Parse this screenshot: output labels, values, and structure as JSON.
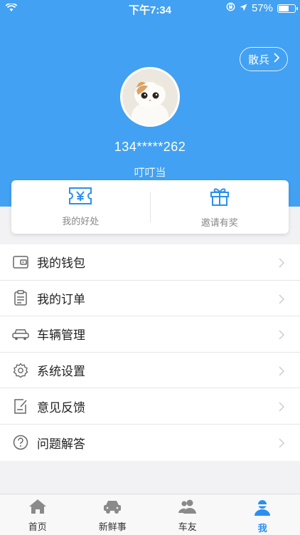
{
  "status_bar": {
    "time": "下午7:34",
    "battery": "57%",
    "battery_level": 0.57
  },
  "header": {
    "group_button": "散兵",
    "phone": "134*****262",
    "nickname": "叮叮当"
  },
  "benefits": [
    {
      "label": "我的好处",
      "icon": "ticket-yen-icon"
    },
    {
      "label": "邀请有奖",
      "icon": "gift-icon"
    }
  ],
  "menu": [
    {
      "label": "我的钱包",
      "icon": "wallet-icon"
    },
    {
      "label": "我的订单",
      "icon": "clipboard-icon"
    },
    {
      "label": "车辆管理",
      "icon": "car-icon"
    },
    {
      "label": "系统设置",
      "icon": "gear-icon"
    },
    {
      "label": "意见反馈",
      "icon": "feedback-icon"
    },
    {
      "label": "问题解答",
      "icon": "question-icon"
    }
  ],
  "tabs": [
    {
      "label": "首页",
      "icon": "home-icon"
    },
    {
      "label": "新鲜事",
      "icon": "car-tab-icon"
    },
    {
      "label": "车友",
      "icon": "people-icon"
    },
    {
      "label": "我",
      "icon": "person-icon"
    }
  ],
  "colors": {
    "primary": "#42a1f2",
    "active_tab": "#2b8ff0"
  }
}
